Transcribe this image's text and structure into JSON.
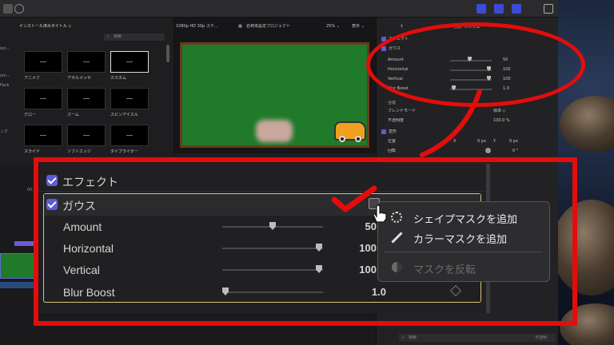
{
  "browser": {
    "title": "インストール済みタイトル ◇",
    "search_placeholder": "検索",
    "side_labels": [
      "ion...",
      "om...",
      "Pack",
      "ング"
    ],
    "thumbnails": [
      {
        "label": "アニメフ"
      },
      {
        "label": "アネルメッセ"
      },
      {
        "label": "カスタム"
      },
      {
        "label": "グロー"
      },
      {
        "label": "ズーム"
      },
      {
        "label": "スピンアイスル"
      },
      {
        "label": "スライド"
      },
      {
        "label": "ソフトエッジ"
      },
      {
        "label": "タイプライター"
      }
    ]
  },
  "viewer": {
    "format": "1080p HD 30p ステ...",
    "project": "名称未設定プロジェクト",
    "zoom": "25% ⌄",
    "display": "表示 ⌄"
  },
  "inspector": {
    "header": "名前: カスタム",
    "effects_label": "エフェクト",
    "gauss_label": "ガウス",
    "params": [
      {
        "name": "Amount",
        "value": "50"
      },
      {
        "name": "Horizontal",
        "value": "100"
      },
      {
        "name": "Vertical",
        "value": "100"
      },
      {
        "name": "Blur Boost",
        "value": "1.0"
      }
    ],
    "compositing_label": "合成",
    "blend_mode_label": "ブレンドモード",
    "blend_mode_value": "標準 ◇",
    "opacity_label": "不透明度",
    "opacity_value": "100.0 %",
    "transform_label": "変形",
    "position_label": "位置",
    "position_x_label": "X",
    "position_x": "0 px",
    "position_y_label": "Y",
    "position_y": "0 px",
    "rotation_label": "回転",
    "rotation_value": "0 °",
    "bottom_search": "検索",
    "bottom_right": "不透明"
  },
  "popup_menu": {
    "items": [
      {
        "label": "シェイプマスクを追加",
        "icon": "shape-mask-icon",
        "enabled": true
      },
      {
        "label": "カラーマスクを追加",
        "icon": "eyedropper-icon",
        "enabled": true
      },
      {
        "label": "マスクを反転",
        "icon": "invert-mask-icon",
        "enabled": false
      }
    ]
  },
  "timeline": {
    "timecode": "00:00:0"
  },
  "colors": {
    "annotation_red": "#e50c0c",
    "checkbox_purple": "#5b5cd6",
    "viewer_green": "#1f7a2a"
  }
}
